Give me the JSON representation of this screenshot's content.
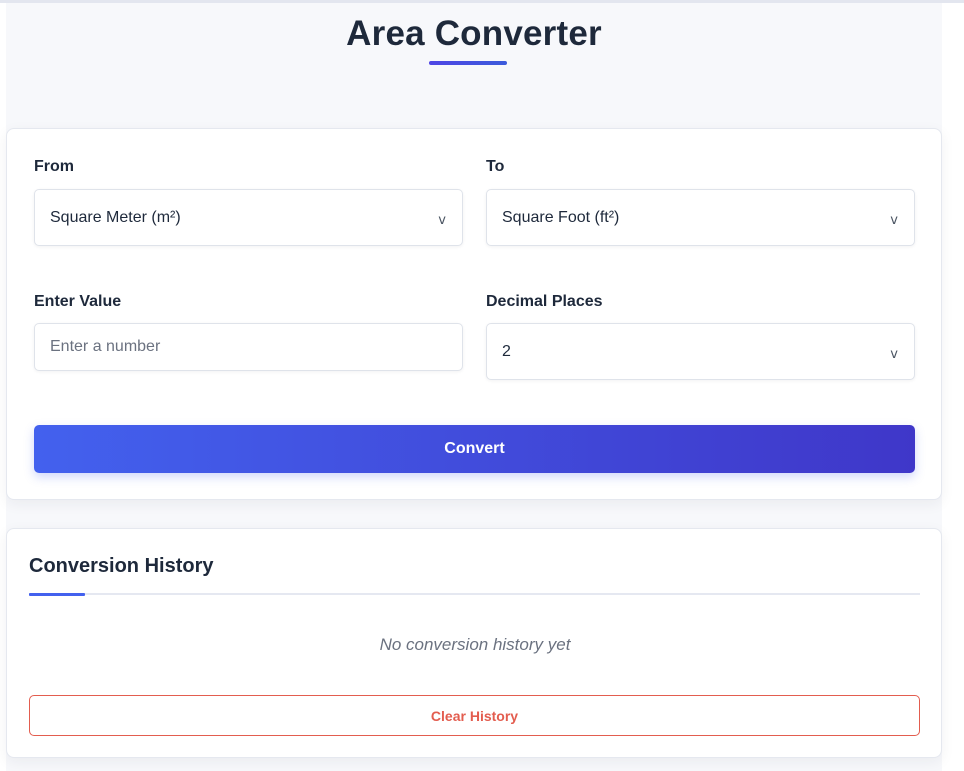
{
  "header": {
    "title": "Area Converter"
  },
  "converter": {
    "from_label": "From",
    "from_value": "Square Meter (m²)",
    "to_label": "To",
    "to_value": "Square Foot (ft²)",
    "value_label": "Enter Value",
    "value_placeholder": "Enter a number",
    "value_current": "",
    "decimals_label": "Decimal Places",
    "decimals_value": "2",
    "convert_label": "Convert"
  },
  "history": {
    "title": "Conversion History",
    "empty_message": "No conversion history yet",
    "clear_label": "Clear History"
  },
  "icons": {
    "dropdown": "chevron-down-icon"
  },
  "colors": {
    "accent_start": "#4361ee",
    "accent_end": "#3f37c9",
    "danger": "#e35d4f",
    "text": "#1e293b",
    "muted": "#6b7280"
  }
}
